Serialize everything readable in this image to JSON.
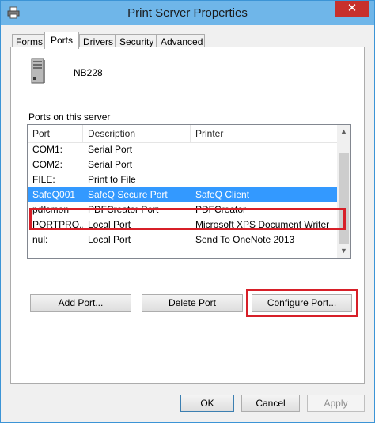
{
  "window": {
    "title": "Print Server Properties",
    "close_glyph": "✕"
  },
  "tabs": [
    {
      "label": "Forms"
    },
    {
      "label": "Ports"
    },
    {
      "label": "Drivers"
    },
    {
      "label": "Security"
    },
    {
      "label": "Advanced"
    }
  ],
  "server": {
    "name": "NB228"
  },
  "ports_section": {
    "label": "Ports on this server",
    "columns": [
      "Port",
      "Description",
      "Printer"
    ],
    "rows": [
      {
        "port": "COM1:",
        "description": "Serial Port",
        "printer": ""
      },
      {
        "port": "COM2:",
        "description": "Serial Port",
        "printer": ""
      },
      {
        "port": "FILE:",
        "description": "Print to File",
        "printer": ""
      },
      {
        "port": "SafeQ001",
        "description": "SafeQ Secure Port",
        "printer": "SafeQ Client"
      },
      {
        "port": "pdfcmon",
        "description": "PDFCreator Port",
        "printer": "PDFCreator"
      },
      {
        "port": "PORTPRO...",
        "description": "Local Port",
        "printer": "Microsoft XPS Document Writer"
      },
      {
        "port": "nul:",
        "description": "Local Port",
        "printer": "Send To OneNote 2013"
      }
    ]
  },
  "buttons": {
    "add_port": "Add Port...",
    "delete_port": "Delete Port",
    "configure_port": "Configure Port...",
    "ok": "OK",
    "cancel": "Cancel",
    "apply": "Apply"
  },
  "icons": {
    "title": "printer-icon",
    "server": "server-tower-icon",
    "scroll_up": "▲",
    "scroll_down": "▼"
  },
  "colors": {
    "selection": "#3399ff",
    "highlight": "#d71f28",
    "titlebar": "#6fb6e9",
    "close": "#c7302c"
  }
}
